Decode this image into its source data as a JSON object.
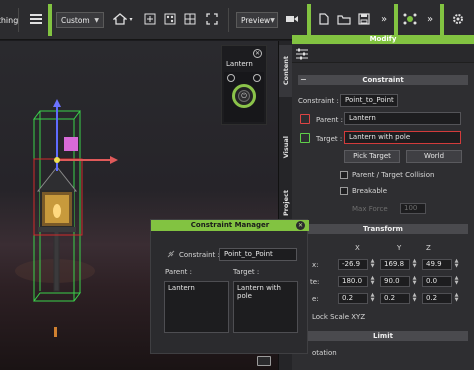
{
  "toolbar": {
    "partial_label": "thing",
    "camera_preset": "Custom",
    "render_mode": "Preview"
  },
  "lantern_widget": {
    "title": "Lantern"
  },
  "vertical_tabs": {
    "content": "Content",
    "visual": "Visual",
    "project": "Project"
  },
  "modify": {
    "header": "Modify",
    "constraint": {
      "section_title": "Constraint",
      "constraint_label": "Constraint :",
      "constraint_value": "Point_to_Point",
      "parent_label": "Parent :",
      "parent_value": "Lantern",
      "target_label": "Target :",
      "target_value": "Lantern with pole",
      "pick_target_label": "Pick Target",
      "world_label": "World",
      "collision_label": "Parent / Target Collision",
      "breakable_label": "Breakable",
      "max_force_label": "Max Force",
      "max_force_value": "100"
    },
    "transform": {
      "section_title": "Transform",
      "x_header": "X",
      "y_header": "Y",
      "z_header": "Z",
      "rows": [
        {
          "label": "x:",
          "x": "-26.9",
          "y": "169.8",
          "z": "49.9"
        },
        {
          "label": "te:",
          "x": "180.0",
          "y": "90.0",
          "z": "0.0"
        },
        {
          "label": "e:",
          "x": "0.2",
          "y": "0.2",
          "z": "0.2"
        }
      ],
      "lock_scale_label": "Lock Scale XYZ"
    },
    "limit": {
      "section_title": "Limit",
      "rotation_label": "otation"
    }
  },
  "constraint_manager": {
    "title": "Constraint Manager",
    "constraint_label": "Constraint :",
    "constraint_value": "Point_to_Point",
    "parent_label": "Parent :",
    "target_label": "Target :",
    "parent_items": [
      "Lantern"
    ],
    "target_items": [
      "Lantern with pole"
    ]
  },
  "colors": {
    "accent_green": "#82c341",
    "highlight_red": "#d23b3b",
    "panel_bg": "#2e2e31"
  }
}
